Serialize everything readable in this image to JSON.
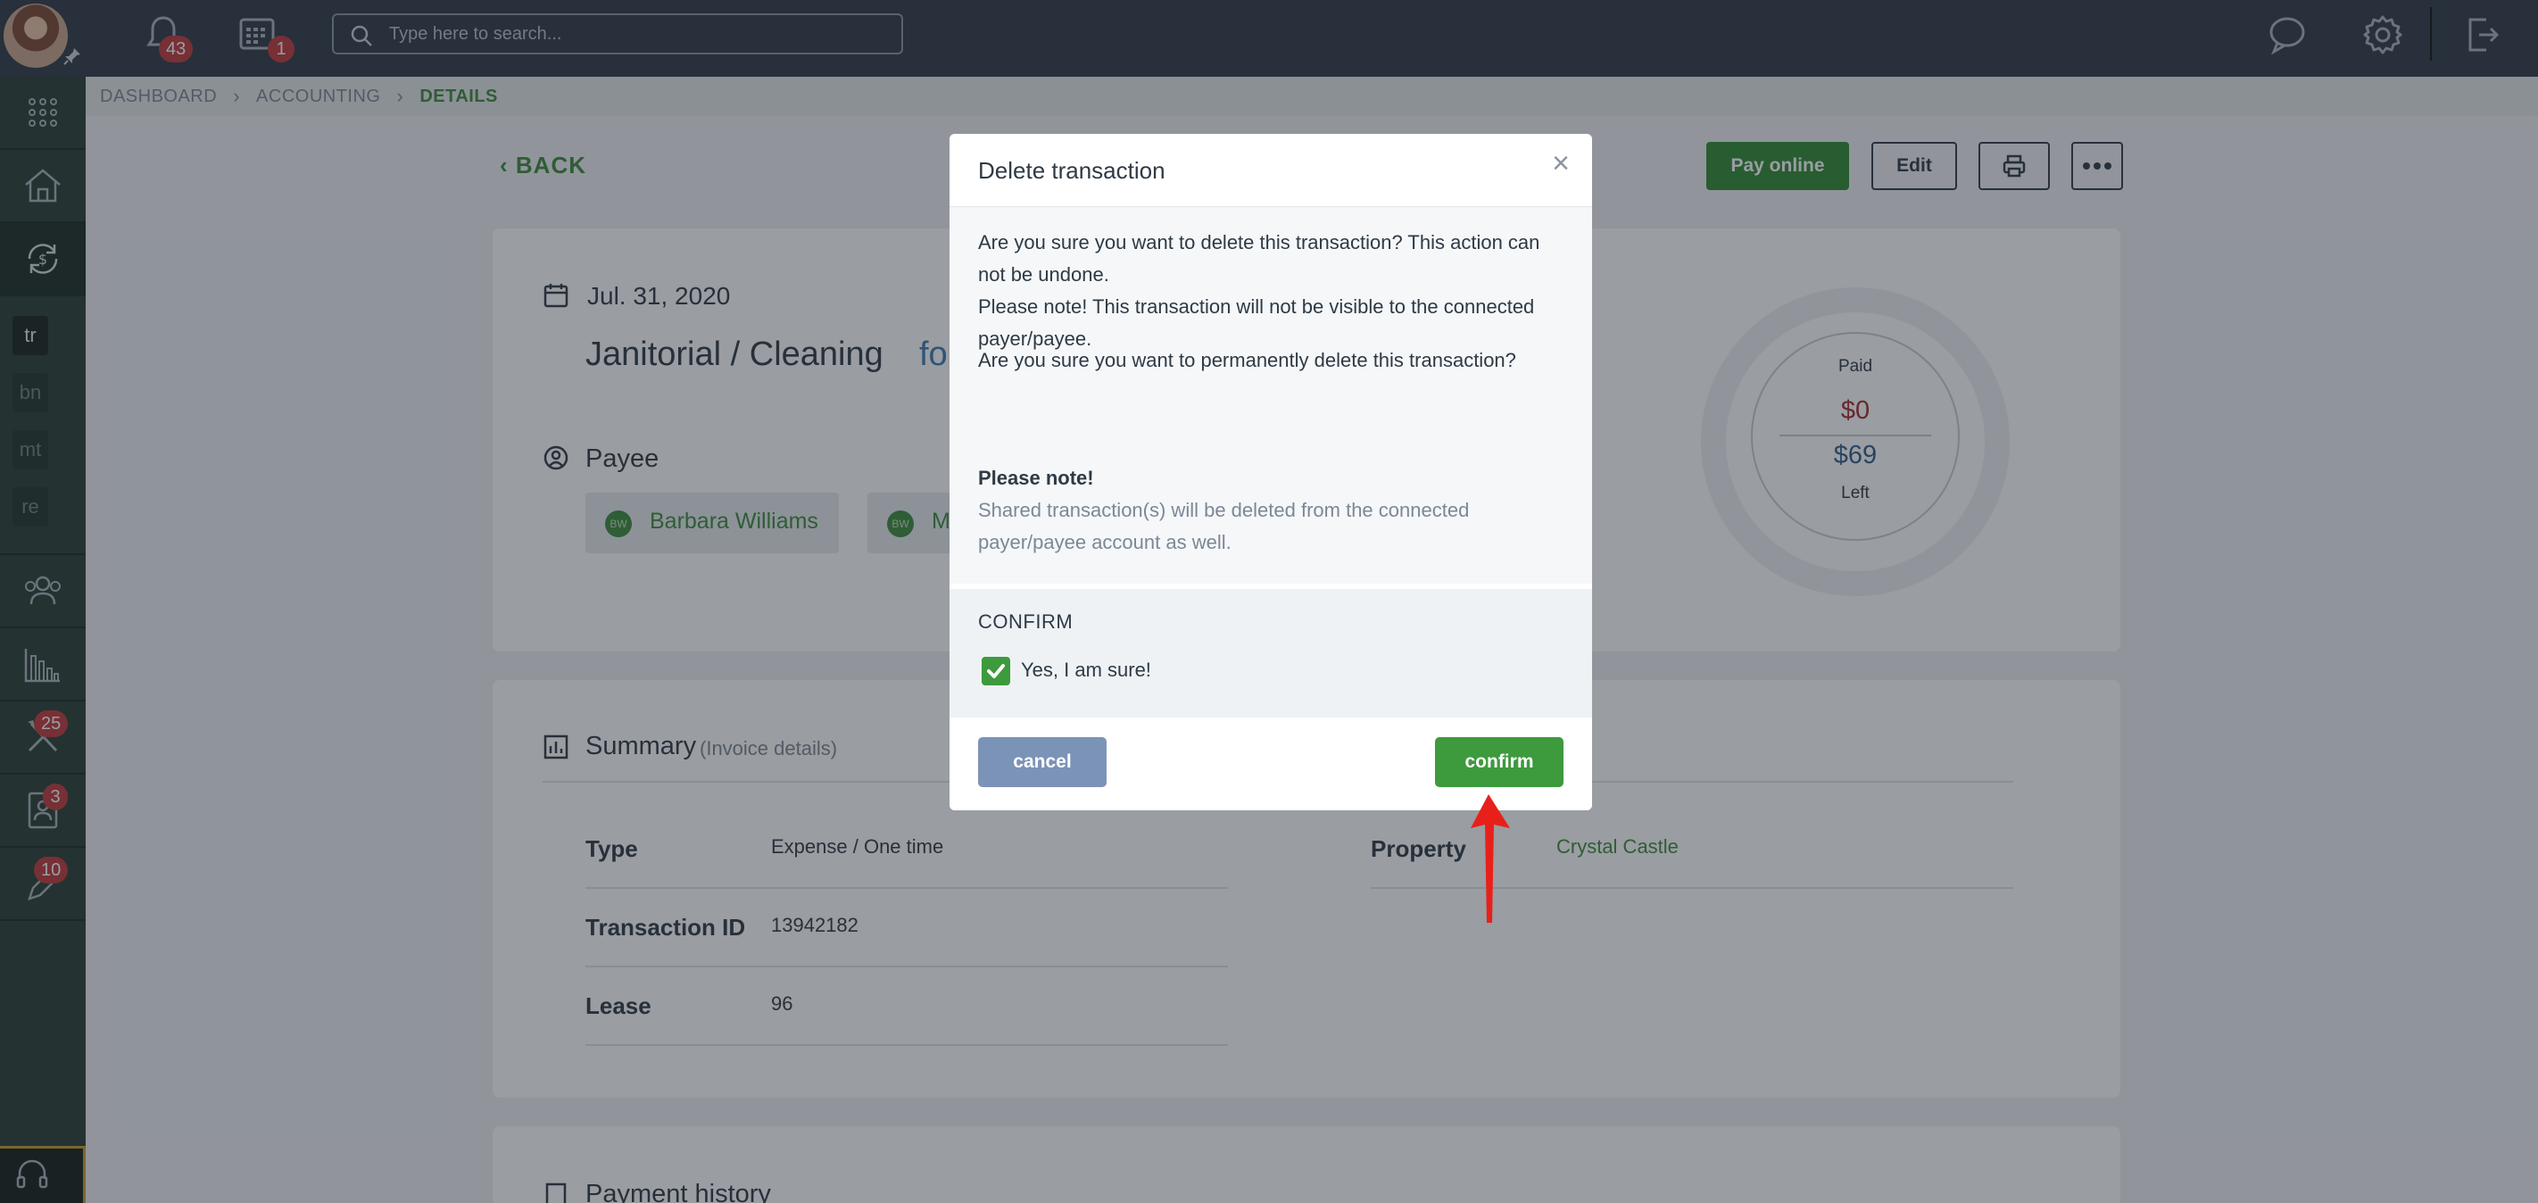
{
  "topbar": {
    "notifications_count": "43",
    "calendar_count": "1",
    "search_placeholder": "Type here to search..."
  },
  "sidebar": {
    "abbr_items": [
      "tr",
      "bn",
      "mt",
      "re"
    ],
    "badges": {
      "maintenance": "25",
      "applicants": "3",
      "tasks": "10"
    }
  },
  "breadcrumb": [
    "DASHBOARD",
    "ACCOUNTING",
    "DETAILS"
  ],
  "header": {
    "back_label": "BACK",
    "pay_online_label": "Pay online",
    "edit_label": "Edit"
  },
  "transaction": {
    "date": "Jul. 31, 2020",
    "title": "Janitorial / Cleaning",
    "title_for": "fo",
    "payee_label": "Payee",
    "payees": [
      {
        "initials": "BW",
        "name": "Barbara Williams"
      },
      {
        "initials": "BW",
        "name": "M"
      }
    ],
    "paid_label": "Paid",
    "paid_amount": "$0",
    "left_amount": "$69",
    "left_label": "Left"
  },
  "summary": {
    "title": "Summary",
    "subtitle": "(Invoice details)",
    "rows": [
      {
        "label": "Type",
        "value": "Expense / One time"
      },
      {
        "label": "Transaction ID",
        "value": "13942182"
      },
      {
        "label": "Lease",
        "value": "96"
      },
      {
        "label": "Property",
        "value": "Crystal Castle"
      }
    ],
    "payment_history_title": "Payment history"
  },
  "modal": {
    "title": "Delete transaction",
    "close_glyph": "×",
    "text1": "Are you sure you want to delete this transaction? This action can not be undone.",
    "text2": "Please note! This transaction will not be visible to the connected payer/payee.",
    "text3": "Are you sure you want to permanently delete this transaction?",
    "note_title": "Please note!",
    "note_text": "Shared transaction(s) will be deleted from the connected payer/payee account as well.",
    "confirm_label": "CONFIRM",
    "checkbox_label": "Yes, I am sure!",
    "checkbox_checked": true,
    "cancel_label": "cancel",
    "confirm_button_label": "confirm"
  },
  "colors": {
    "accent_green": "#3d9a3d",
    "topbar": "#2f3a45",
    "sidebar": "#283c33",
    "badge_red": "#c0393b",
    "annotation_arrow": "#e8201a"
  }
}
